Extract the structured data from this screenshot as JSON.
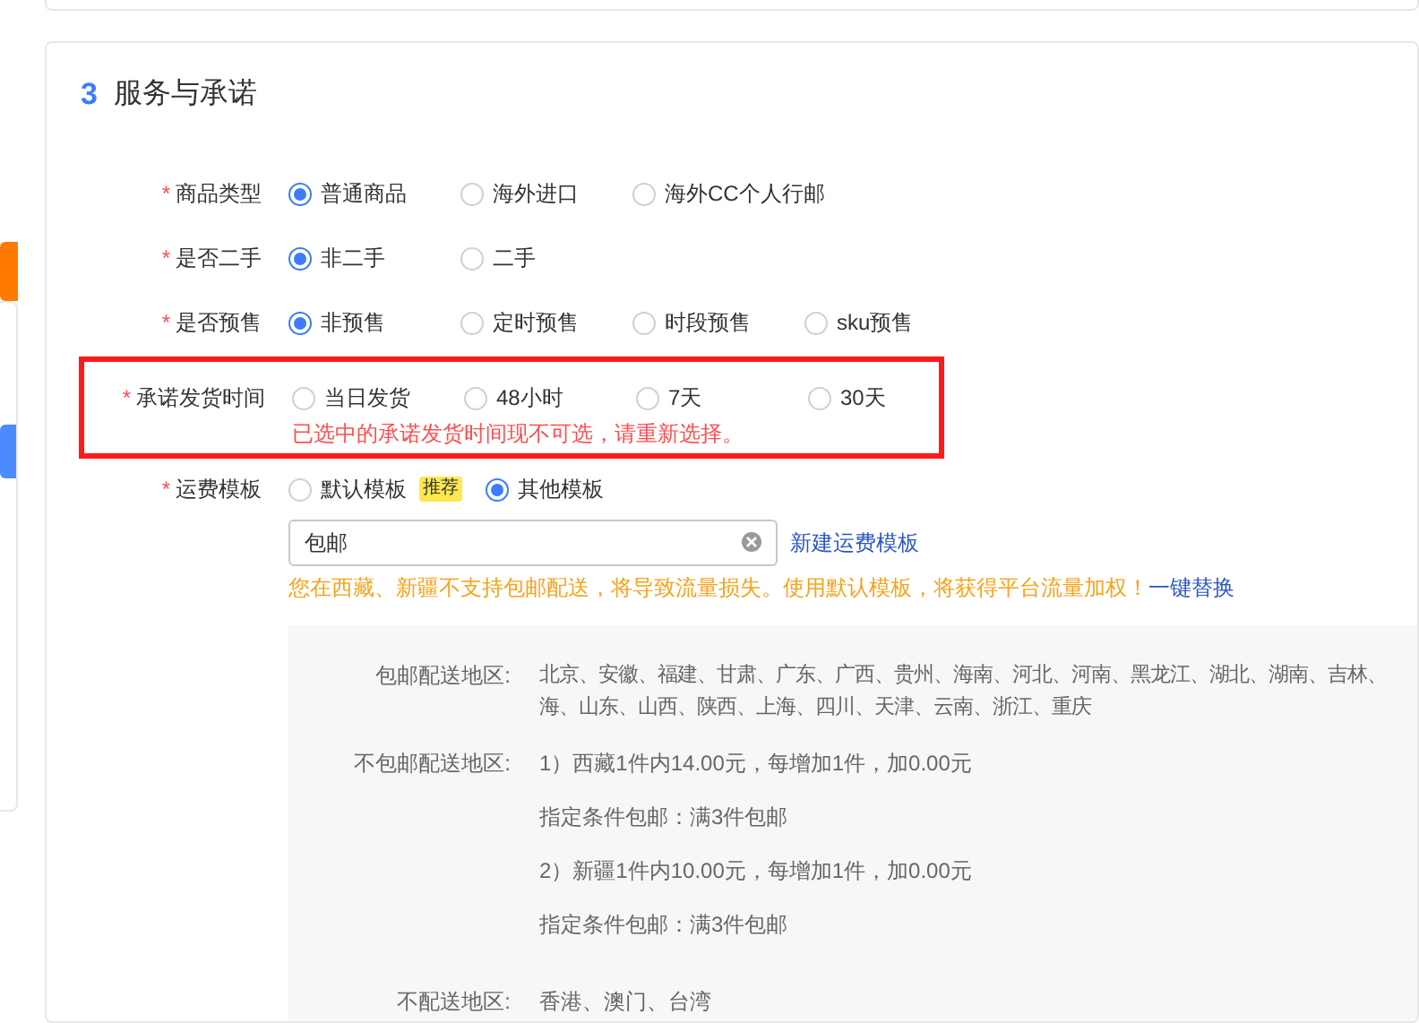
{
  "section": {
    "number": "3",
    "title": "服务与承诺"
  },
  "fields": [
    {
      "kind": "radio",
      "label": "商品类型",
      "required_mark": "*",
      "highlighted": false,
      "options": [
        {
          "label": "普通商品",
          "selected": true
        },
        {
          "label": "海外进口",
          "selected": false
        },
        {
          "label": "海外CC个人行邮",
          "selected": false
        }
      ]
    },
    {
      "kind": "radio",
      "label": "是否二手",
      "required_mark": "*",
      "highlighted": false,
      "options": [
        {
          "label": "非二手",
          "selected": true
        },
        {
          "label": "二手",
          "selected": false
        }
      ]
    },
    {
      "kind": "radio",
      "label": "是否预售",
      "required_mark": "*",
      "highlighted": false,
      "options": [
        {
          "label": "非预售",
          "selected": true
        },
        {
          "label": "定时预售",
          "selected": false
        },
        {
          "label": "时段预售",
          "selected": false
        },
        {
          "label": "sku预售",
          "selected": false
        }
      ]
    },
    {
      "kind": "radio",
      "label": "承诺发货时间",
      "required_mark": "*",
      "highlighted": true,
      "error": "已选中的承诺发货时间现不可选，请重新选择。",
      "options": [
        {
          "label": "当日发货",
          "selected": false
        },
        {
          "label": "48小时",
          "selected": false
        },
        {
          "label": "7天",
          "selected": false
        },
        {
          "label": "30天",
          "selected": false
        }
      ]
    },
    {
      "kind": "template",
      "label": "运费模板",
      "required_mark": "*",
      "highlighted": false,
      "options": [
        {
          "label": "默认模板",
          "selected": false,
          "badge": "推荐"
        },
        {
          "label": "其他模板",
          "selected": true
        }
      ],
      "input": {
        "value": "包邮"
      },
      "link": "新建运费模板",
      "warning": "您在西藏、新疆不支持包邮配送，将导致流量损失。使用默认模板，将获得平台流量加权！",
      "warning_link": "一键替换",
      "details": [
        {
          "label": "包邮配送地区:",
          "lines": [
            "北京、安徽、福建、甘肃、广东、广西、贵州、海南、河北、河南、黑龙江、湖北、湖南、吉林、",
            "海、山东、山西、陕西、上海、四川、天津、云南、浙江、重庆"
          ]
        },
        {
          "label": "不包邮配送地区:",
          "lines": [
            "1）西藏1件内14.00元，每增加1件，加0.00元",
            "指定条件包邮：满3件包邮",
            "2）新疆1件内10.00元，每增加1件，加0.00元",
            "指定条件包邮：满3件包邮"
          ]
        },
        {
          "label": "不配送地区:",
          "lines": [
            "香港、澳门、台湾"
          ]
        }
      ]
    }
  ]
}
